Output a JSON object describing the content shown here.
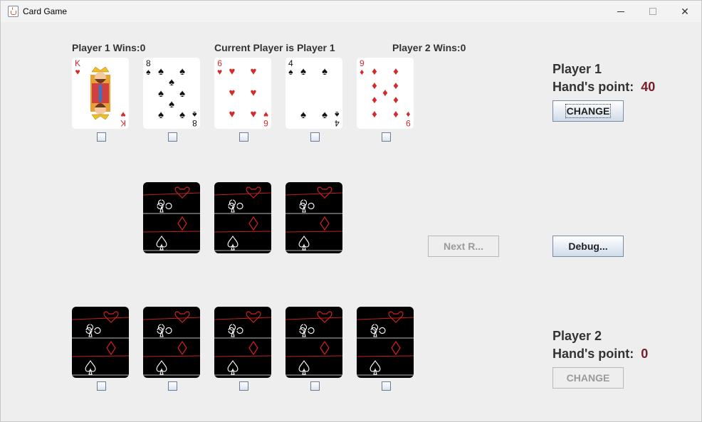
{
  "window": {
    "title": "Card Game",
    "minimize": "—",
    "maximize": "☐",
    "close": "✕"
  },
  "header": {
    "player1_wins": "Player 1 Wins:0",
    "current_player": "Current Player is Player 1",
    "player2_wins": "Player 2 Wins:0"
  },
  "player1": {
    "name": "Player 1",
    "hand_label": "Hand's point:",
    "hand_points": "40",
    "change_label": "CHANGE"
  },
  "player2": {
    "name": "Player 2",
    "hand_label": "Hand's point:",
    "hand_points": "0",
    "change_label": "CHANGE"
  },
  "controls": {
    "next_round_label": "Next R...",
    "debug_label": "Debug..."
  },
  "player1_hand": [
    {
      "rank": "K",
      "suit": "♥",
      "suit_name": "hearts",
      "color": "#d42a2a"
    },
    {
      "rank": "8",
      "suit": "♠",
      "suit_name": "spades",
      "color": "#111111"
    },
    {
      "rank": "6",
      "suit": "♥",
      "suit_name": "hearts",
      "color": "#d42a2a"
    },
    {
      "rank": "4",
      "suit": "♠",
      "suit_name": "spades",
      "color": "#111111"
    },
    {
      "rank": "9",
      "suit": "♦",
      "suit_name": "diamonds",
      "color": "#d42a2a"
    }
  ],
  "middle_face_down_count": 3,
  "player2_face_down_count": 5
}
